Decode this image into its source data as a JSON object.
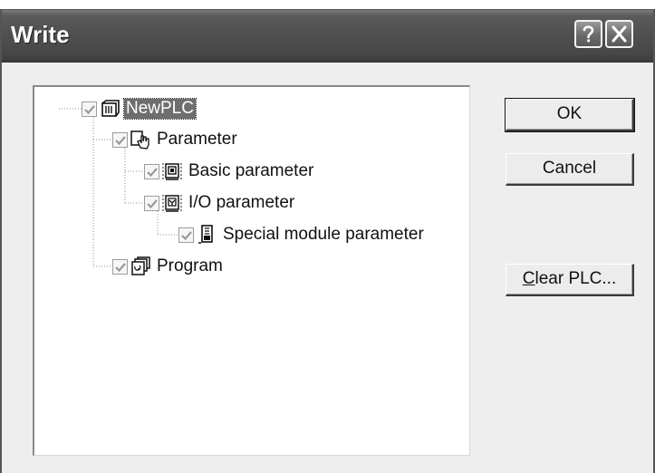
{
  "window": {
    "title": "Write"
  },
  "titlebar_buttons": {
    "help_icon": "question-mark-icon",
    "close_icon": "close-x-icon"
  },
  "tree": {
    "nodes": [
      {
        "label": "NewPLC",
        "checked": true,
        "icon": "plc-project-icon",
        "selected": true
      },
      {
        "label": "Parameter",
        "checked": true,
        "icon": "parameter-hand-icon"
      },
      {
        "label": "Basic parameter",
        "checked": true,
        "icon": "basic-parameter-icon"
      },
      {
        "label": "I/O parameter",
        "checked": true,
        "icon": "io-parameter-icon"
      },
      {
        "label": "Special module parameter",
        "checked": true,
        "icon": "special-module-icon"
      },
      {
        "label": "Program",
        "checked": true,
        "icon": "program-icon"
      }
    ]
  },
  "buttons": {
    "ok": "OK",
    "cancel": "Cancel",
    "clear_mnemonic": "C",
    "clear_rest": "lear PLC..."
  },
  "colors": {
    "titlebar": "#4f4f4f",
    "selection": "#6e6e6e",
    "dialog_bg": "#eeeeee"
  }
}
